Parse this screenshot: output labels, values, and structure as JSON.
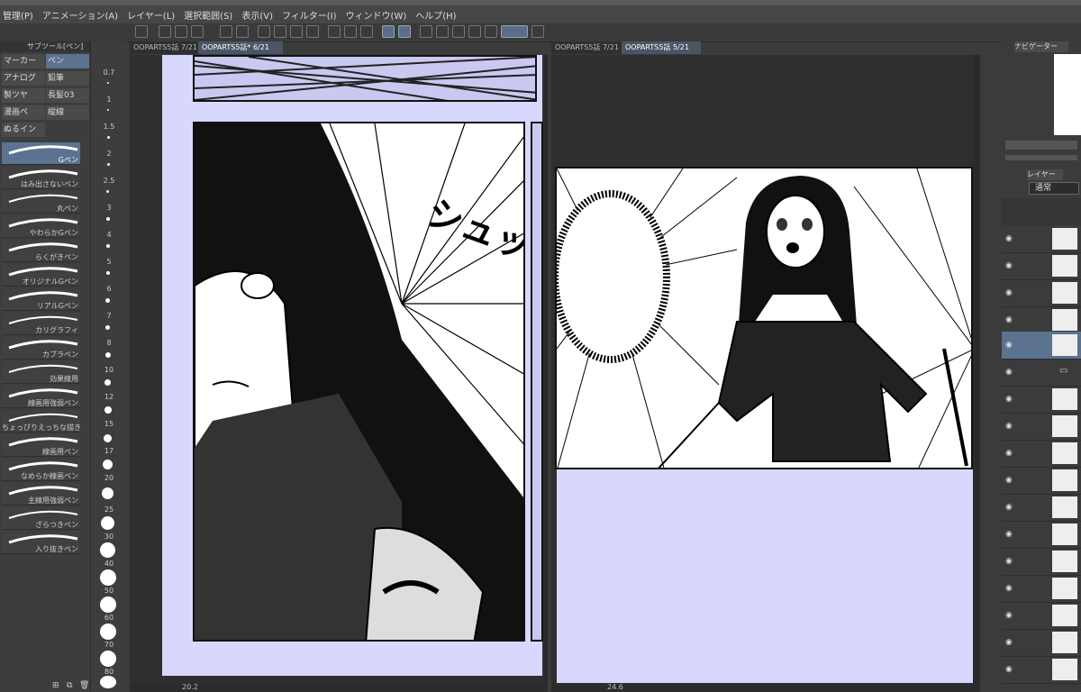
{
  "menu": [
    "管理(P)",
    "アニメーション(A)",
    "レイヤー(L)",
    "選択範囲(S)",
    "表示(V)",
    "フィルター(I)",
    "ウィンドウ(W)",
    "ヘルプ(H)"
  ],
  "subtool_panel": {
    "header": "サブツール[ペン]",
    "tools": [
      "マーカー",
      "ペン",
      "アナログ",
      "鉛筆",
      "製ツヤ",
      "長髪03",
      "漫画ペ",
      "縦線",
      "ぬるイン"
    ],
    "selected_tool": "ペン",
    "brushes": [
      "Gペン",
      "はみ出さないペン",
      "丸ペン",
      "やわらかGペン",
      "らくがきペン",
      "オリジナルGペン",
      "リアルGペン",
      "カリグラフィ",
      "カブラペン",
      "効果線用",
      "線画用強弱ペン",
      "ちょっぴりえっちな描き文",
      "線画用ペン",
      "なめらか線画ペン",
      "主線用強弱ペン",
      "ざらつきペン",
      "入り抜きペン"
    ],
    "selected_brush": "Gペン"
  },
  "brush_sizes": [
    "0.7",
    "1",
    "1.5",
    "2",
    "2.5",
    "3",
    "4",
    "5",
    "6",
    "7",
    "8",
    "10",
    "12",
    "15",
    "17",
    "20",
    "25",
    "30",
    "40",
    "50",
    "60",
    "70",
    "80"
  ],
  "tabs_left": [
    "OOPARTS5話 7/21",
    "OOPARTS5話* 6/21"
  ],
  "tabs_right": [
    "OOPARTS5話 7/21",
    "OOPARTS5話 5/21"
  ],
  "active_tabs": [
    "OOPARTS5話* 6/21",
    "OOPARTS5話 5/21"
  ],
  "manga_sfx": "シュッ",
  "status_left": {
    "zoom": "20.2"
  },
  "status_right": {
    "zoom": "24.6"
  },
  "navigator_tab": "ナビゲーター",
  "layer_tab": "レイヤー",
  "blend_mode": "通常",
  "colors": {
    "page": "#d8d8ff",
    "accent": "#5b7290",
    "ui_bg": "#3d3d3d"
  }
}
